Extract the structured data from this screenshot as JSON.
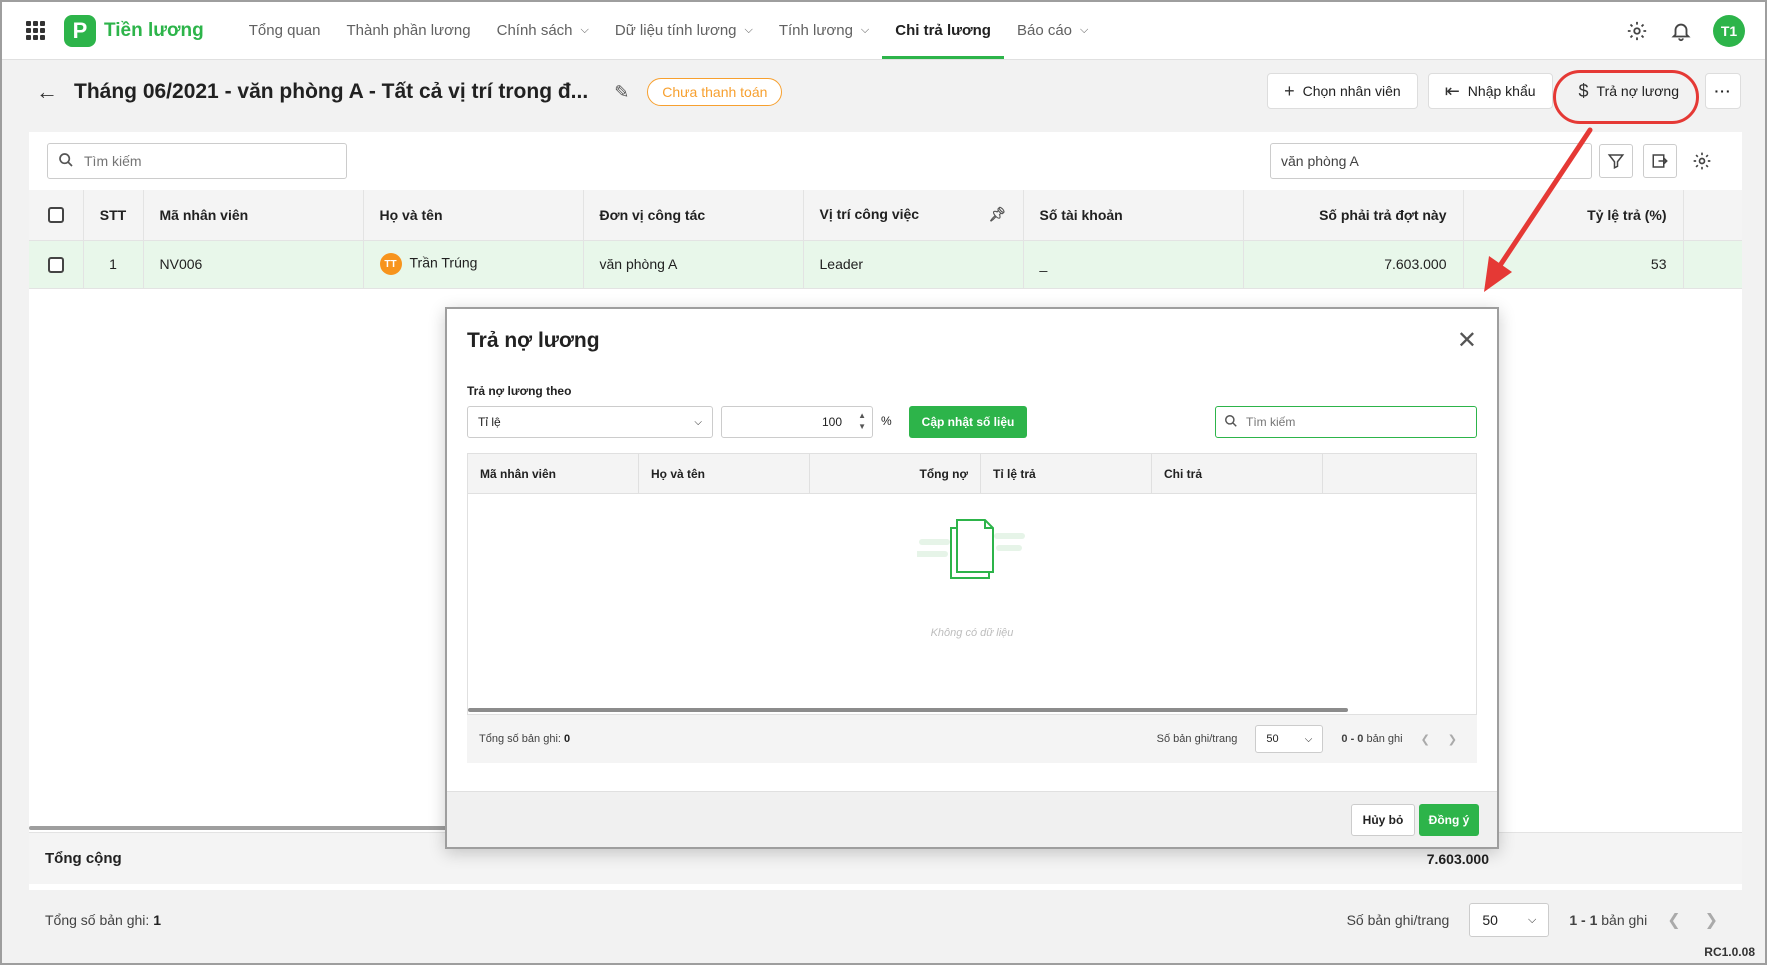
{
  "app": {
    "name": "Tiền lương",
    "logo_letter": "P",
    "user_initials": "T1",
    "accent": "#2db44a"
  },
  "nav": [
    {
      "label": "Tổng quan",
      "dropdown": false,
      "active": false
    },
    {
      "label": "Thành phần lương",
      "dropdown": false,
      "active": false
    },
    {
      "label": "Chính sách",
      "dropdown": true,
      "active": false
    },
    {
      "label": "Dữ liệu tính lương",
      "dropdown": true,
      "active": false
    },
    {
      "label": "Tính lương",
      "dropdown": true,
      "active": false
    },
    {
      "label": "Chi trả lương",
      "dropdown": false,
      "active": true
    },
    {
      "label": "Báo cáo",
      "dropdown": true,
      "active": false
    }
  ],
  "header": {
    "title": "Tháng 06/2021 - văn phòng A - Tất cả vị trí trong đ...",
    "status": "Chưa thanh toán",
    "actions": {
      "add_employee": "Chọn nhân viên",
      "import": "Nhập khẩu",
      "debt_repay": "Trả nợ lương"
    }
  },
  "toolbar": {
    "search_placeholder": "Tìm kiếm",
    "unit_filter": "văn phòng A"
  },
  "table": {
    "columns": [
      "STT",
      "Mã nhân viên",
      "Họ và tên",
      "Đơn vị công tác",
      "Vị trí công việc",
      "Số tài khoản",
      "Số phải trả đợt này",
      "Tỷ lệ trả (%)"
    ],
    "rows": [
      {
        "stt": "1",
        "code": "NV006",
        "avatar": "TT",
        "name": "Trần Trúng",
        "unit": "văn phòng A",
        "position": "Leader",
        "account": "_",
        "amount": "7.603.000",
        "ratio": "53"
      }
    ],
    "total_label": "Tổng cộng",
    "total_amount": "7.603.000"
  },
  "footer": {
    "total_records_label": "Tổng số bản ghi:",
    "total_records": "1",
    "page_size_label": "Số bản ghi/trang",
    "page_size": "50",
    "range": "1 - 1",
    "range_suffix": "bản ghi"
  },
  "version": "RC1.0.08",
  "modal": {
    "title": "Trả nợ lương",
    "repay_by_label": "Trả nợ lương theo",
    "repay_by_value": "Tỉ lệ",
    "ratio_value": "100",
    "percent_sign": "%",
    "update_button": "Cập nhật số liệu",
    "search_placeholder": "Tìm kiếm",
    "columns": [
      "Mã nhân viên",
      "Họ và tên",
      "Tổng nợ",
      "Tỉ lệ trả",
      "Chi trả"
    ],
    "empty_text": "Không có dữ liệu",
    "total_records_label": "Tổng số bản ghi:",
    "total_records": "0",
    "page_size_label": "Số bản ghi/trang",
    "page_size": "50",
    "range": "0 - 0",
    "range_suffix": "bản ghi",
    "cancel": "Hủy bỏ",
    "ok": "Đồng ý"
  }
}
